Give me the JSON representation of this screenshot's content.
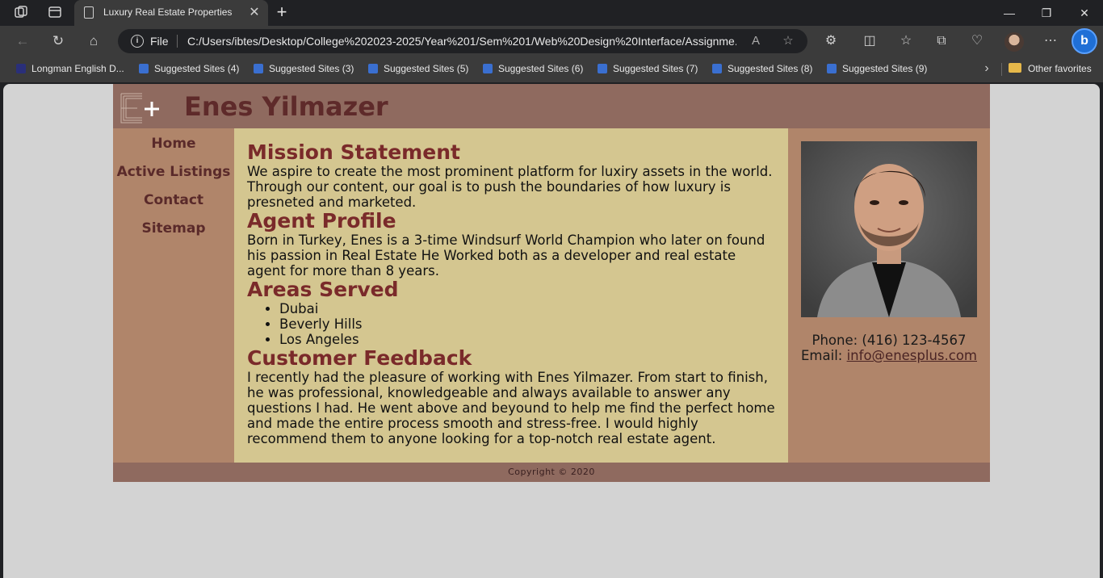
{
  "browser": {
    "tab_title": "Luxury Real Estate Properties",
    "address_scheme_label": "File",
    "url": "C:/Users/ibtes/Desktop/College%202023-2025/Year%201/Sem%201/Web%20Design%20Interface/Assignme...",
    "favorites": [
      {
        "label": "Longman English D...",
        "icon_color": "#2a2f7a"
      },
      {
        "label": "Suggested Sites (4)",
        "icon_color": "#3a6fd0"
      },
      {
        "label": "Suggested Sites (3)",
        "icon_color": "#3a6fd0"
      },
      {
        "label": "Suggested Sites (5)",
        "icon_color": "#3a6fd0"
      },
      {
        "label": "Suggested Sites (6)",
        "icon_color": "#3a6fd0"
      },
      {
        "label": "Suggested Sites (7)",
        "icon_color": "#3a6fd0"
      },
      {
        "label": "Suggested Sites (8)",
        "icon_color": "#3a6fd0"
      },
      {
        "label": "Suggested Sites (9)",
        "icon_color": "#3a6fd0"
      }
    ],
    "other_favorites": "Other favorites"
  },
  "site": {
    "title": "Enes Yilmazer",
    "logo_text": "E+",
    "nav": [
      "Home",
      "Active Listings",
      "Contact",
      "Sitemap"
    ],
    "mission": {
      "heading": "Mission Statement",
      "text": "We aspire to create the most prominent platform for luxiry assets in the world. Through our content, our goal is to push the boundaries of how luxury is presneted and marketed."
    },
    "profile": {
      "heading": "Agent Profile",
      "text": "Born in Turkey, Enes is a 3-time Windsurf World Champion who later on found his passion in Real Estate He Worked both as a developer and real estate agent for more than 8 years."
    },
    "areas": {
      "heading": "Areas Served",
      "items": [
        "Dubai",
        "Beverly Hills",
        "Los Angeles"
      ]
    },
    "feedback": {
      "heading": "Customer Feedback",
      "text": "I recently had the pleasure of working with Enes Yilmazer. From start to finish, he was professional, knowledgeable and always available to answer any questions I had. He went above and beyound to help me find the perfect home and made the entire process smooth and stress-free. I would highly recommend them to anyone looking for a top-notch real estate agent."
    },
    "contact": {
      "phone": "Phone: (416) 123-4567",
      "email_label": "Email:",
      "email": "info@enesplus.com"
    },
    "footer": "Copyright © 2020"
  },
  "colors": {
    "header_bg": "#8f6a5f",
    "side_bg": "#b0856a",
    "main_bg": "#d4c690",
    "heading": "#7a2a2a",
    "page_bg": "#d3d3d3"
  }
}
